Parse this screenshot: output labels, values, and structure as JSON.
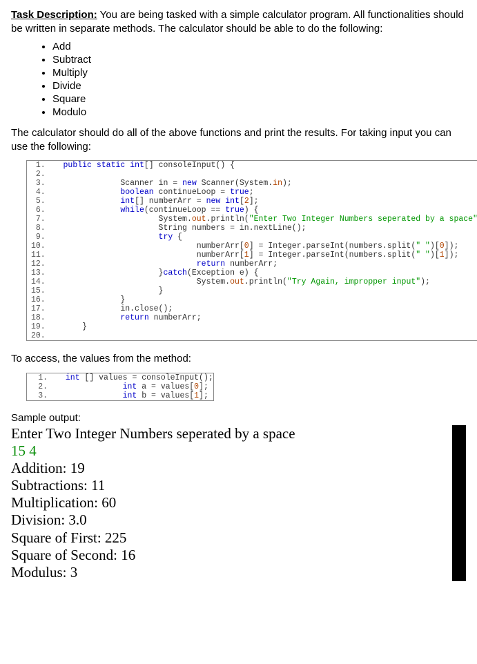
{
  "task_label": "Task Description:",
  "intro": " You are being tasked with a simple calculator program. All functionalities should be written in separate methods. The calculator should be able to do the following:",
  "funcs": [
    "Add",
    "Subtract",
    "Multiply",
    "Divide",
    "Square",
    "Modulo"
  ],
  "after_list": "The calculator should do all of the above functions and print the results. For taking input you can use the following:",
  "code1": [
    {
      "n": "1.",
      "pre": "  ",
      "tokens": [
        {
          "t": "public",
          "c": "kw"
        },
        {
          "t": " "
        },
        {
          "t": "static",
          "c": "kw"
        },
        {
          "t": " "
        },
        {
          "t": "int",
          "c": "typ"
        },
        {
          "t": "[] consoleInput() {"
        }
      ]
    },
    {
      "n": "2.",
      "pre": "",
      "tokens": []
    },
    {
      "n": "3.",
      "pre": "              ",
      "tokens": [
        {
          "t": "Scanner in = "
        },
        {
          "t": "new",
          "c": "kw"
        },
        {
          "t": " Scanner(System."
        },
        {
          "t": "in",
          "c": "num"
        },
        {
          "t": ");"
        }
      ]
    },
    {
      "n": "4.",
      "pre": "              ",
      "tokens": [
        {
          "t": "boolean",
          "c": "typ"
        },
        {
          "t": " continueLoop = "
        },
        {
          "t": "true",
          "c": "kw"
        },
        {
          "t": ";"
        }
      ]
    },
    {
      "n": "5.",
      "pre": "              ",
      "tokens": [
        {
          "t": "int",
          "c": "typ"
        },
        {
          "t": "[] numberArr = "
        },
        {
          "t": "new",
          "c": "kw"
        },
        {
          "t": " "
        },
        {
          "t": "int",
          "c": "typ"
        },
        {
          "t": "["
        },
        {
          "t": "2",
          "c": "num"
        },
        {
          "t": "];"
        }
      ]
    },
    {
      "n": "6.",
      "pre": "              ",
      "tokens": [
        {
          "t": "while",
          "c": "kw"
        },
        {
          "t": "(continueLoop == "
        },
        {
          "t": "true",
          "c": "kw"
        },
        {
          "t": ") {"
        }
      ]
    },
    {
      "n": "7.",
      "pre": "                      ",
      "tokens": [
        {
          "t": "System."
        },
        {
          "t": "out",
          "c": "num"
        },
        {
          "t": ".println("
        },
        {
          "t": "\"Enter Two Integer Numbers seperated by a space\"",
          "c": "str"
        },
        {
          "t": ");"
        }
      ]
    },
    {
      "n": "8.",
      "pre": "                      ",
      "tokens": [
        {
          "t": "String numbers = in.nextLine();"
        }
      ]
    },
    {
      "n": "9.",
      "pre": "                      ",
      "tokens": [
        {
          "t": "try",
          "c": "kw"
        },
        {
          "t": " {"
        }
      ]
    },
    {
      "n": "10.",
      "pre": "                              ",
      "tokens": [
        {
          "t": "numberArr["
        },
        {
          "t": "0",
          "c": "num"
        },
        {
          "t": "] = Integer.parseInt(numbers.split("
        },
        {
          "t": "\" \"",
          "c": "str"
        },
        {
          "t": ")["
        },
        {
          "t": "0",
          "c": "num"
        },
        {
          "t": "]);"
        }
      ]
    },
    {
      "n": "11.",
      "pre": "                              ",
      "tokens": [
        {
          "t": "numberArr["
        },
        {
          "t": "1",
          "c": "num"
        },
        {
          "t": "] = Integer.parseInt(numbers.split("
        },
        {
          "t": "\" \"",
          "c": "str"
        },
        {
          "t": ")["
        },
        {
          "t": "1",
          "c": "num"
        },
        {
          "t": "]);"
        }
      ]
    },
    {
      "n": "12.",
      "pre": "                              ",
      "tokens": [
        {
          "t": "return",
          "c": "kw"
        },
        {
          "t": " numberArr;"
        }
      ]
    },
    {
      "n": "13.",
      "pre": "                      ",
      "tokens": [
        {
          "t": "}"
        },
        {
          "t": "catch",
          "c": "kw"
        },
        {
          "t": "(Exception e) {"
        }
      ]
    },
    {
      "n": "14.",
      "pre": "                              ",
      "tokens": [
        {
          "t": "System."
        },
        {
          "t": "out",
          "c": "num"
        },
        {
          "t": ".println("
        },
        {
          "t": "\"Try Again, impropper input\"",
          "c": "str"
        },
        {
          "t": ");"
        }
      ]
    },
    {
      "n": "15.",
      "pre": "                      ",
      "tokens": [
        {
          "t": "}"
        }
      ]
    },
    {
      "n": "16.",
      "pre": "              ",
      "tokens": [
        {
          "t": "}"
        }
      ]
    },
    {
      "n": "17.",
      "pre": "              ",
      "tokens": [
        {
          "t": "in.close();"
        }
      ]
    },
    {
      "n": "18.",
      "pre": "              ",
      "tokens": [
        {
          "t": "return",
          "c": "kw"
        },
        {
          "t": " numberArr;"
        }
      ]
    },
    {
      "n": "19.",
      "pre": "      ",
      "tokens": [
        {
          "t": "}"
        }
      ]
    },
    {
      "n": "20.",
      "pre": "",
      "tokens": []
    }
  ],
  "between_code": "To access, the values from the method:",
  "code2": [
    {
      "n": "1.",
      "pre": "  ",
      "tokens": [
        {
          "t": "int",
          "c": "typ"
        },
        {
          "t": " [] values = consoleInput();"
        }
      ]
    },
    {
      "n": "2.",
      "pre": "              ",
      "tokens": [
        {
          "t": "int",
          "c": "typ"
        },
        {
          "t": " a = values["
        },
        {
          "t": "0",
          "c": "num"
        },
        {
          "t": "];"
        }
      ]
    },
    {
      "n": "3.",
      "pre": "              ",
      "tokens": [
        {
          "t": "int",
          "c": "typ"
        },
        {
          "t": " b = values["
        },
        {
          "t": "1",
          "c": "num"
        },
        {
          "t": "];"
        }
      ]
    }
  ],
  "sample_label": "Sample output:",
  "console": {
    "line1": "Enter Two Integer Numbers seperated by a space",
    "input": "15 4",
    "lines": [
      "Addition: 19",
      "Subtractions: 11",
      "Multiplication: 60",
      "Division: 3.0",
      "Square of First: 225",
      "Square of Second: 16",
      "Modulus: 3"
    ]
  }
}
